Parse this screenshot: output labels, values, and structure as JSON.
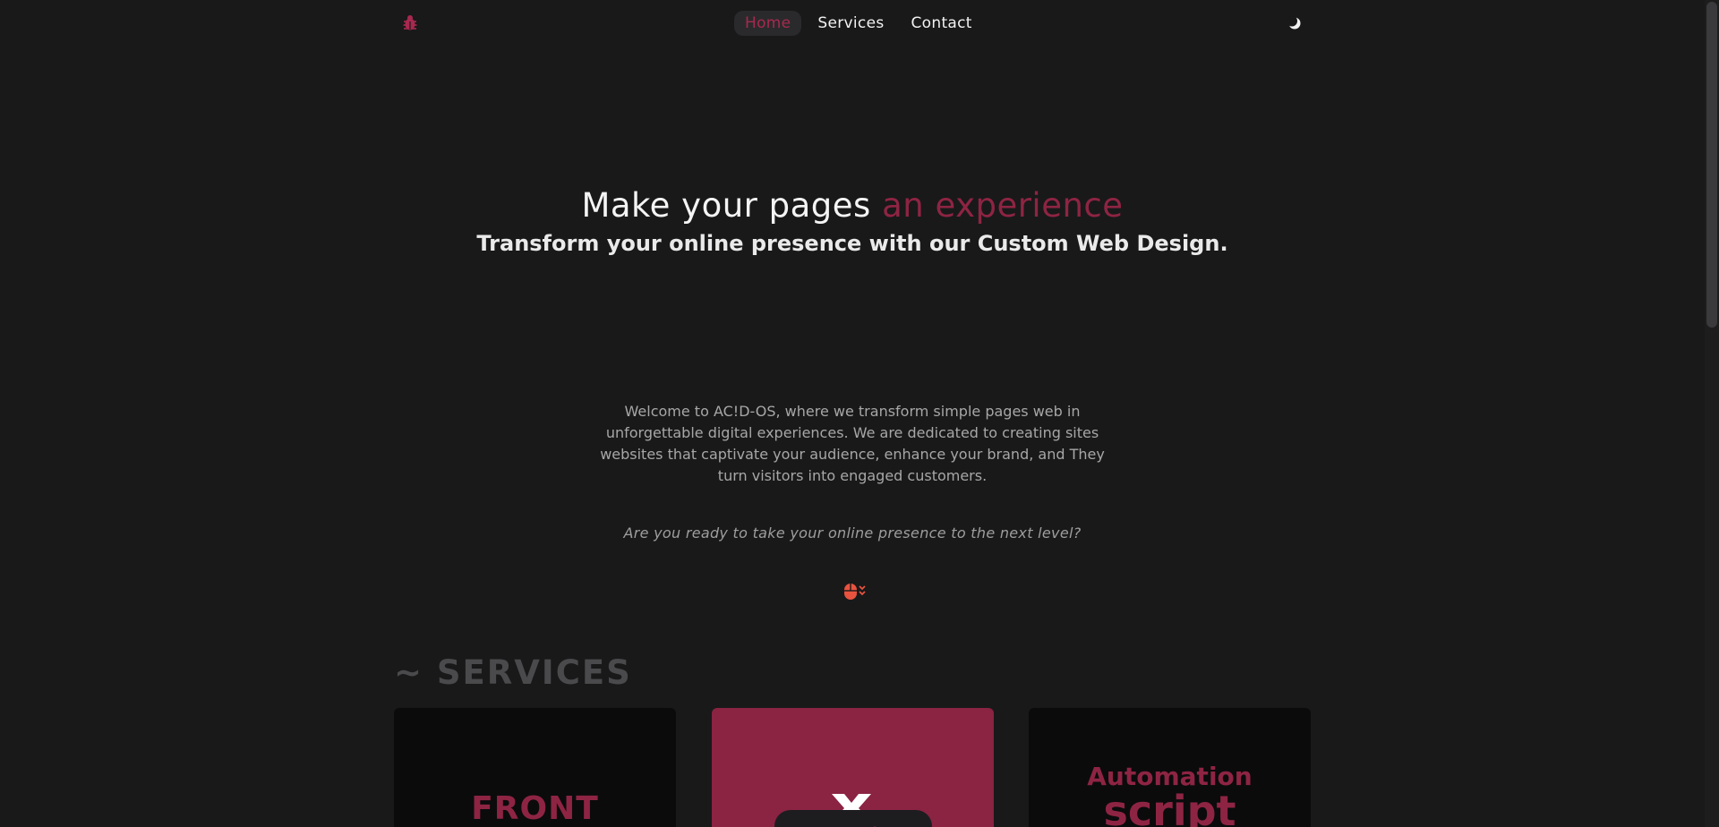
{
  "nav": {
    "links": [
      {
        "label": "Home",
        "active": true
      },
      {
        "label": "Services",
        "active": false
      },
      {
        "label": "Contact",
        "active": false
      }
    ],
    "logo_icon": "bug-icon",
    "theme_icon": "moon-icon"
  },
  "hero": {
    "title_main": "Make your pages ",
    "title_accent": "an experience",
    "subtitle": "Transform your online presence with our Custom Web Design."
  },
  "intro": {
    "text": "Welcome to AC!D-OS, where we transform simple pages web in unforgettable digital experiences. We are dedicated to creating sites websites that captivate your audience, enhance your brand, and They turn visitors into engaged customers.",
    "question": "Are you ready to take your online presence to the next level?"
  },
  "services": {
    "title": "~ SERVICES",
    "cards": [
      {
        "label": "FRONT"
      },
      {
        "label": ""
      },
      {
        "label_top": "Automation",
        "label_bottom": "script"
      }
    ]
  },
  "colors": {
    "background": "#19191a",
    "accent": "#8e2443",
    "card_dark": "#0b0b0c",
    "card_accent": "#8b2342"
  }
}
